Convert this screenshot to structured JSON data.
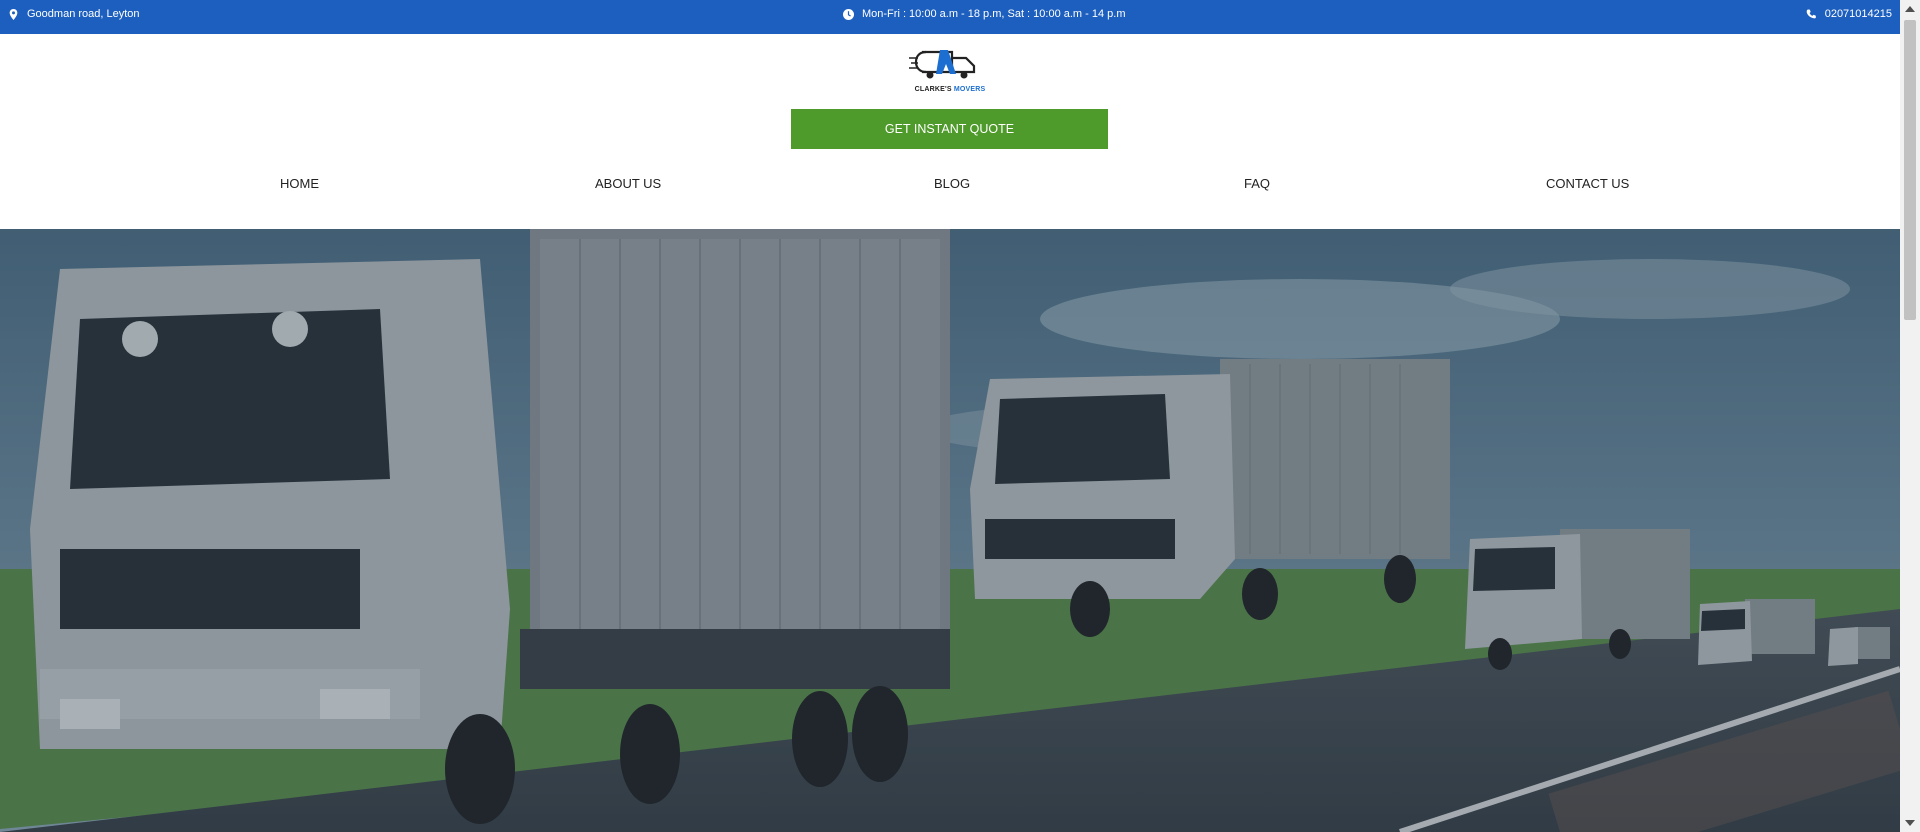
{
  "topbar": {
    "address": "Goodman road, Leyton",
    "hours": "Mon-Fri : 10:00 a.m - 18 p.m, Sat : 10:00 a.m - 14 p.m",
    "phone": "02071014215",
    "address_icon": "location-pin-icon",
    "hours_icon": "clock-icon",
    "phone_icon": "phone-icon",
    "bg_color": "#1c5fbf"
  },
  "logo": {
    "text_main": "CLARKE'S ",
    "text_accent": "MOVERS"
  },
  "quote_button": {
    "label": "GET INSTANT QUOTE",
    "color": "#4e9a2a"
  },
  "nav": {
    "items": [
      {
        "label": "HOME"
      },
      {
        "label": "ABOUT US"
      },
      {
        "label": "BLOG"
      },
      {
        "label": "FAQ"
      },
      {
        "label": "CONTACT US"
      }
    ]
  }
}
